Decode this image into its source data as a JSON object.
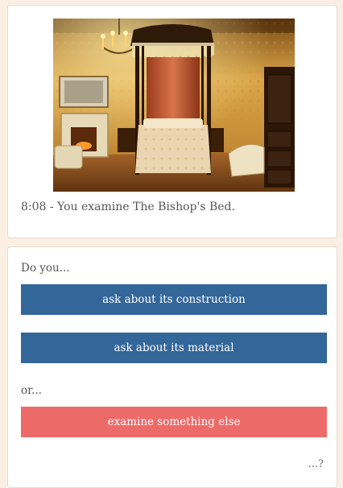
{
  "scene": {
    "image_subject": "The Bishop's Bed",
    "caption": "8:08 - You examine The Bishop's Bed."
  },
  "choices": {
    "intro": "Do you...",
    "options": [
      {
        "label": "ask about its construction",
        "style": "primary",
        "color": "#336699"
      },
      {
        "label": "ask about its material",
        "style": "primary",
        "color": "#336699"
      }
    ],
    "alt_intro": "or...",
    "alt_option": {
      "label": "examine something else",
      "style": "secondary",
      "color": "#ec6a68"
    },
    "trailing": "...?"
  }
}
